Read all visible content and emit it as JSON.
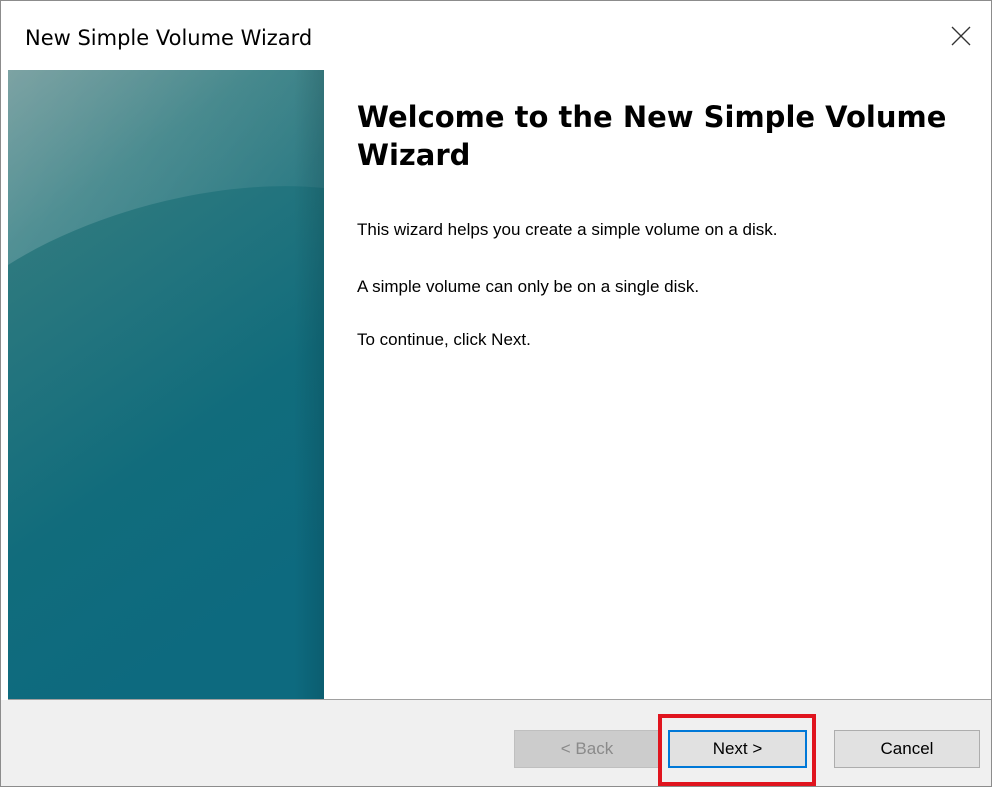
{
  "window": {
    "title": "New Simple Volume Wizard"
  },
  "content": {
    "heading": "Welcome to the New Simple Volume Wizard",
    "paragraphs": [
      "This wizard helps you create a simple volume on a disk.",
      "A simple volume can only be on a single disk.",
      "To continue, click Next."
    ]
  },
  "buttons": {
    "back": "< Back",
    "next": "Next >",
    "cancel": "Cancel"
  },
  "icons": {
    "close": "close-icon"
  },
  "colors": {
    "banner_top": "#4f8a8e",
    "banner_bottom": "#0b6b80",
    "focus_border": "#0078d7",
    "highlight": "#e0141e",
    "footer_bg": "#f0f0f0"
  }
}
